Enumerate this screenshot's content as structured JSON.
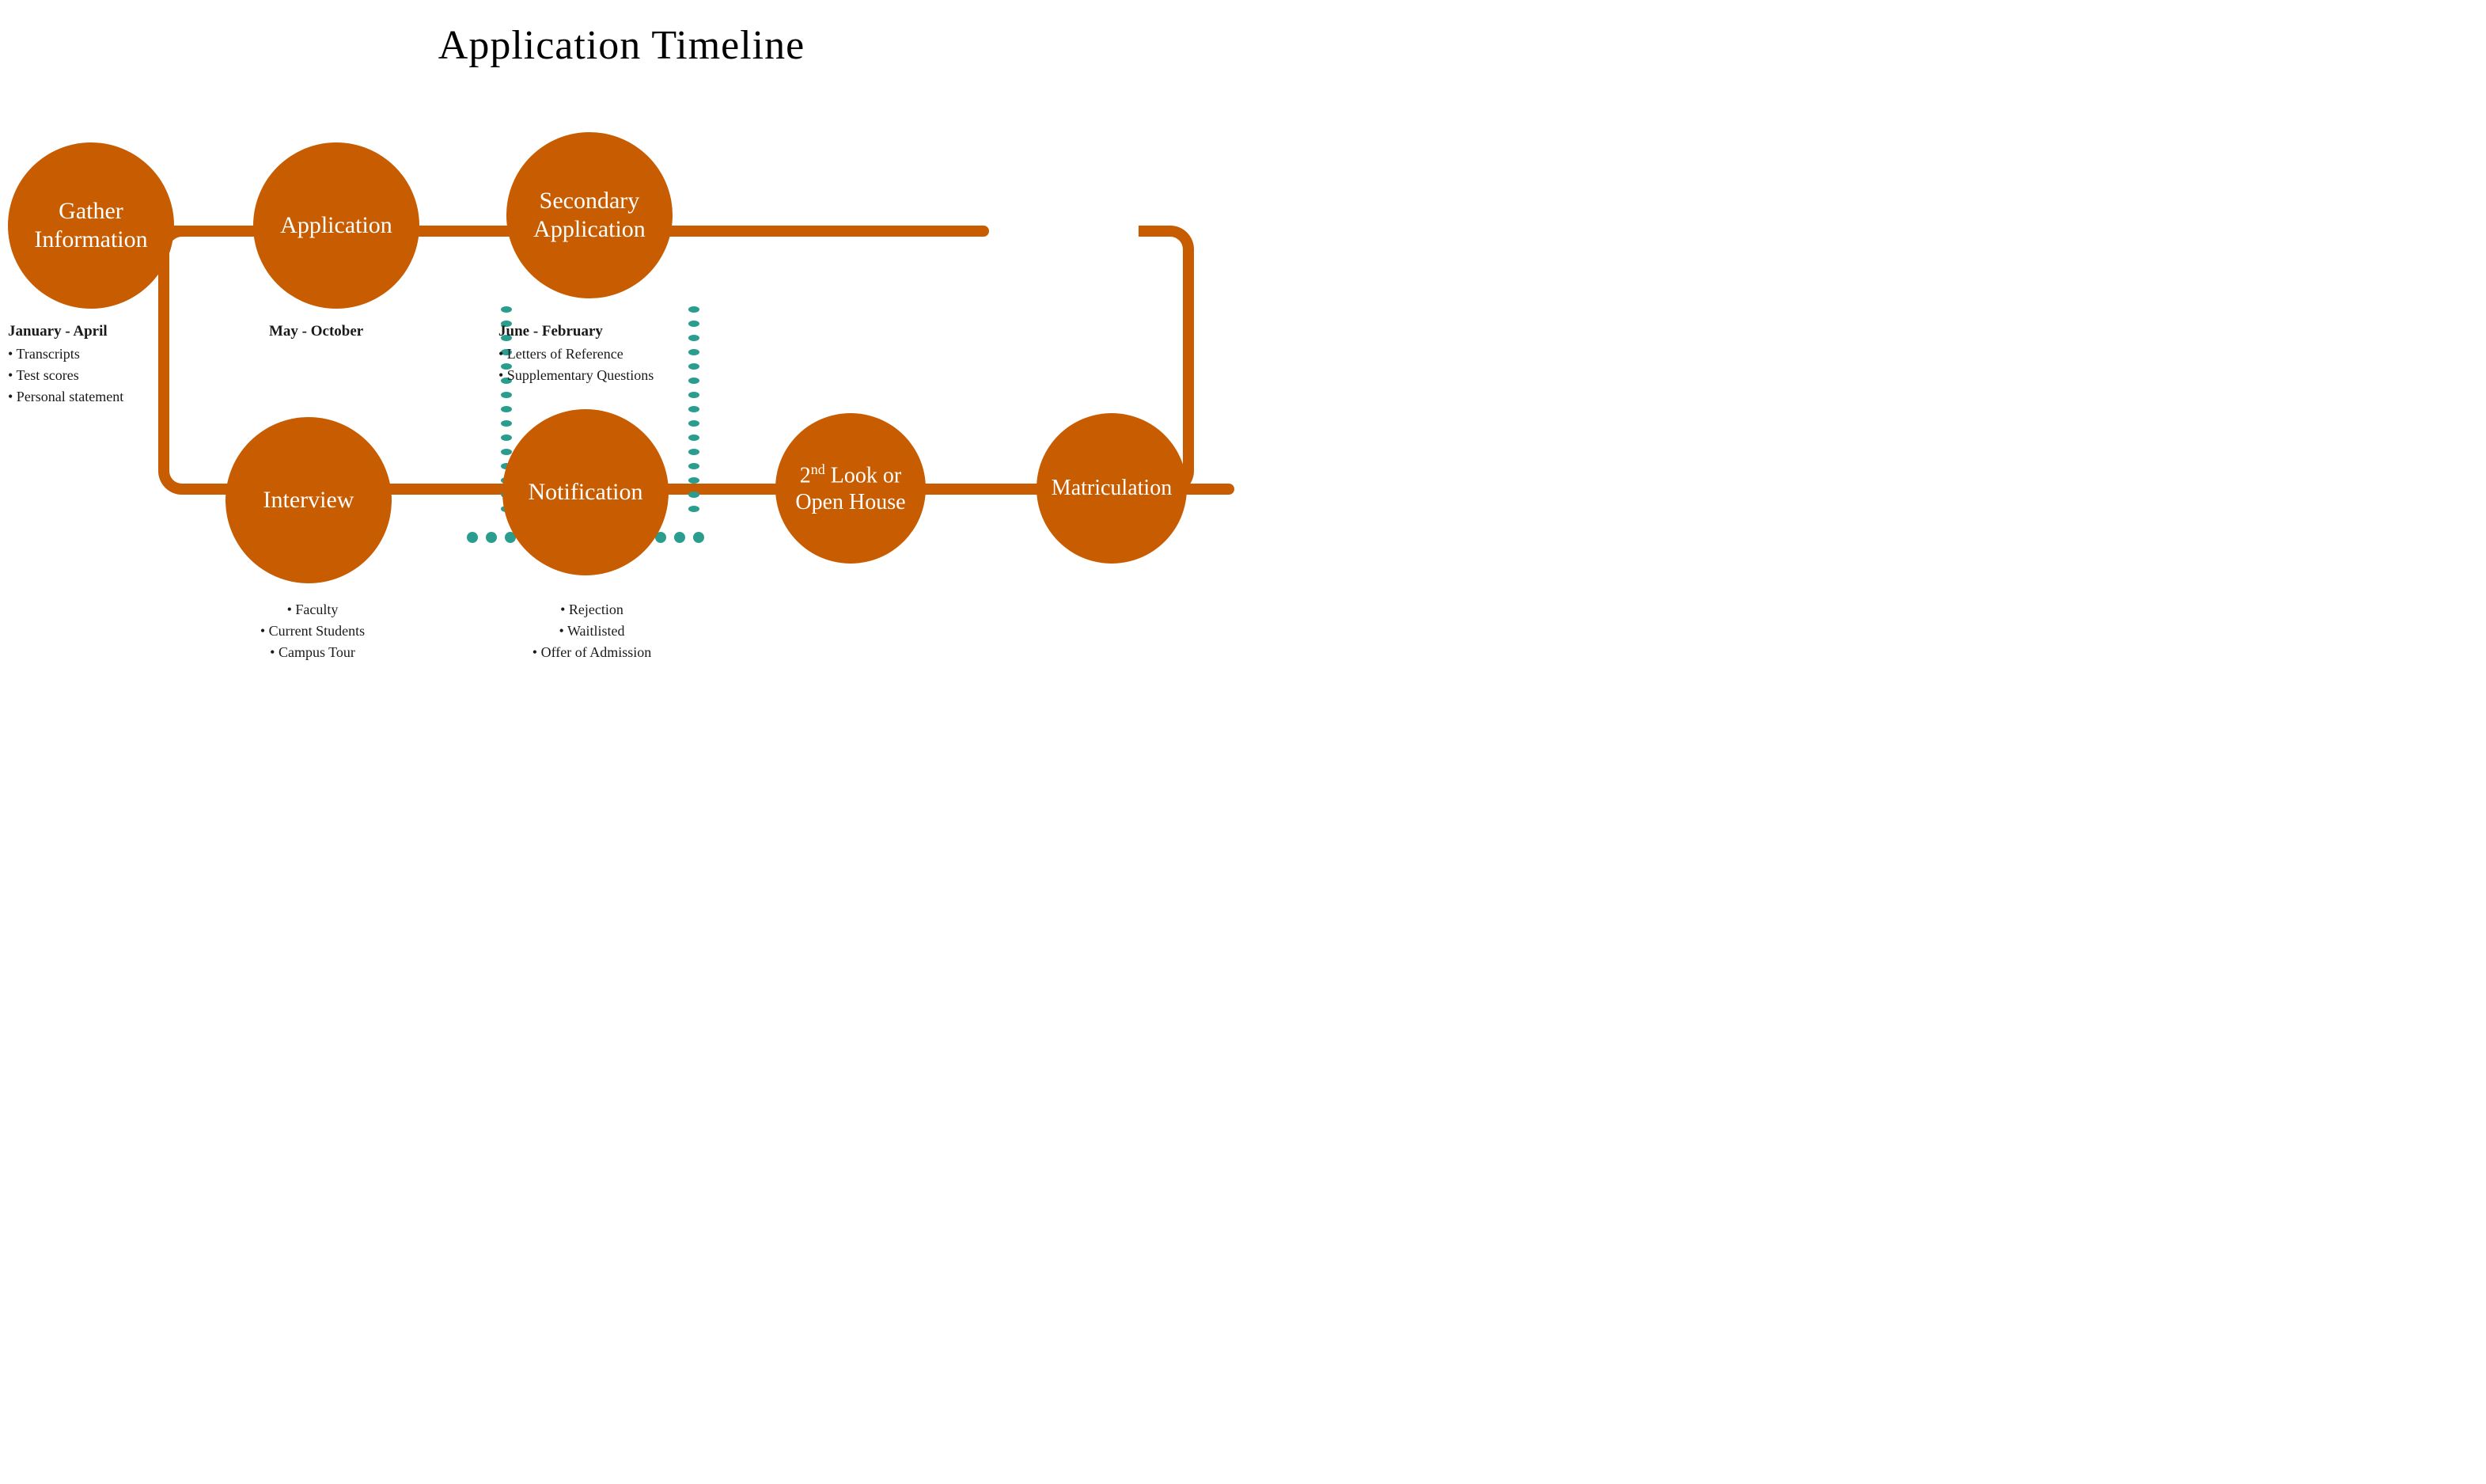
{
  "page": {
    "title": "Application Timeline"
  },
  "circles": {
    "gather": {
      "label": "Gather\nInformation",
      "date": "January - April",
      "bullets": [
        "Transcripts",
        "Test scores",
        "Personal statement"
      ]
    },
    "application": {
      "label": "Application",
      "date": "May - October",
      "bullets": []
    },
    "secondary": {
      "label": "Secondary\nApplication",
      "date": "June - February",
      "bullets": [
        "Letters of Reference",
        "Supplementary Questions"
      ]
    },
    "interview": {
      "label": "Interview",
      "date": "",
      "bullets": [
        "Faculty",
        "Current Students",
        "Campus Tour"
      ]
    },
    "notification": {
      "label": "Notification",
      "date": "",
      "bullets": [
        "Rejection",
        "Waitlisted",
        "Offer of Admission"
      ]
    },
    "second_look": {
      "label": "2nd Look or\nOpen House",
      "date": "",
      "bullets": []
    },
    "matriculation": {
      "label": "Matriculation",
      "date": "",
      "bullets": []
    }
  },
  "colors": {
    "orange": "#C85C00",
    "teal": "#2A9D8F",
    "text": "#1a1a1a",
    "white": "#ffffff",
    "background": "#ffffff"
  }
}
